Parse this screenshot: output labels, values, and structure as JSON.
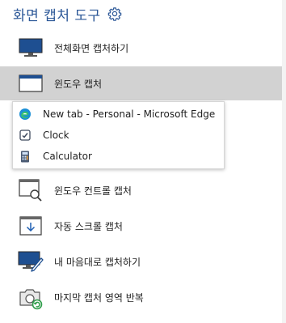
{
  "header": {
    "title": "화면 캡처 도구",
    "settings_icon": "gear-icon"
  },
  "menu": {
    "items": [
      {
        "label": "전체화면 캡처하기",
        "icon": "monitor-icon"
      },
      {
        "label": "윈도우 캡처",
        "icon": "window-icon",
        "selected": true
      },
      {
        "label": "윈도우 컨트롤 캡처",
        "icon": "window-control-search-icon"
      },
      {
        "label": "자동 스크롤 캡처",
        "icon": "scroll-down-icon"
      },
      {
        "label": "내 마음대로 캡처하기",
        "icon": "monitor-pen-icon"
      },
      {
        "label": "마지막 캡처 영역 반복",
        "icon": "camera-repeat-icon"
      }
    ]
  },
  "window_list": {
    "items": [
      {
        "label": "New tab - Personal - Microsoft Edge",
        "icon": "edge-icon"
      },
      {
        "label": "Clock",
        "icon": "clock-icon"
      },
      {
        "label": "Calculator",
        "icon": "calculator-icon"
      }
    ]
  },
  "colors": {
    "accent": "#2b5797",
    "selected_bg": "#d2d2d2",
    "icon_blue": "#1e4f91"
  }
}
